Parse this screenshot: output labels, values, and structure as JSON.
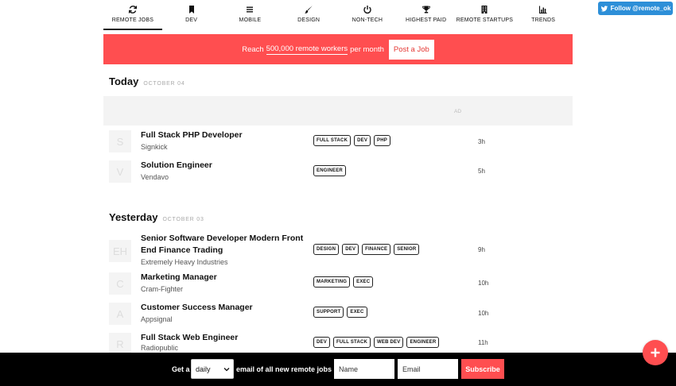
{
  "nav": [
    {
      "label": "REMOTE JOBS",
      "icon": "refresh-icon",
      "active": true
    },
    {
      "label": "DEV",
      "icon": "bookmark-icon"
    },
    {
      "label": "MOBILE",
      "icon": "menu-icon"
    },
    {
      "label": "DESIGN",
      "icon": "brush-icon"
    },
    {
      "label": "NON-TECH",
      "icon": "power-icon"
    },
    {
      "label": "HIGHEST PAID",
      "icon": "trophy-icon"
    },
    {
      "label": "REMOTE STARTUPS",
      "icon": "building-icon"
    },
    {
      "label": "TRENDS",
      "icon": "bar-chart-icon"
    }
  ],
  "twitter": {
    "label": "Follow @remote_ok",
    "icon": "twitter-bird-icon"
  },
  "banner": {
    "prefix": "Reach",
    "highlight": "500,000 remote workers",
    "suffix": "per month",
    "button": "Post a Job"
  },
  "today": {
    "title": "Today",
    "date": "OCTOBER 04"
  },
  "ad_label": "AD",
  "yesterday": {
    "title": "Yesterday",
    "date": "OCTOBER 03"
  },
  "jobs": [
    {
      "logo": "S",
      "title": "Full Stack PHP Developer",
      "company": "Signkick",
      "tags": [
        "FULL STACK",
        "DEV",
        "PHP"
      ],
      "age": "3h"
    },
    {
      "logo": "V",
      "title": "Solution Engineer",
      "company": "Vendavo",
      "tags": [
        "ENGINEER"
      ],
      "age": "5h"
    },
    {
      "logo": "EH",
      "title": "Senior Software Developer Modern Front End Finance Trading",
      "company": "Extremely Heavy Industries",
      "tags": [
        "DESIGN",
        "DEV",
        "FINANCE",
        "SENIOR"
      ],
      "age": "9h"
    },
    {
      "logo": "C",
      "title": "Marketing Manager",
      "company": "Cram-Fighter",
      "tags": [
        "MARKETING",
        "EXEC"
      ],
      "age": "10h"
    },
    {
      "logo": "A",
      "title": "Customer Success Manager",
      "company": "Appsignal",
      "tags": [
        "SUPPORT",
        "EXEC"
      ],
      "age": "10h"
    },
    {
      "logo": "R",
      "title": "Full Stack Web Engineer",
      "company": "Radiopublic",
      "tags": [
        "DEV",
        "FULL STACK",
        "WEB DEV",
        "ENGINEER"
      ],
      "age": "11h"
    }
  ],
  "subscribe": {
    "prefix": "Get a",
    "frequency": "daily",
    "suffix": "email of all new remote jobs",
    "name_placeholder": "Name",
    "email_placeholder": "Email",
    "button": "Subscribe"
  },
  "colors": {
    "accent": "#ff4e50",
    "twitter": "#2d8fd8"
  }
}
